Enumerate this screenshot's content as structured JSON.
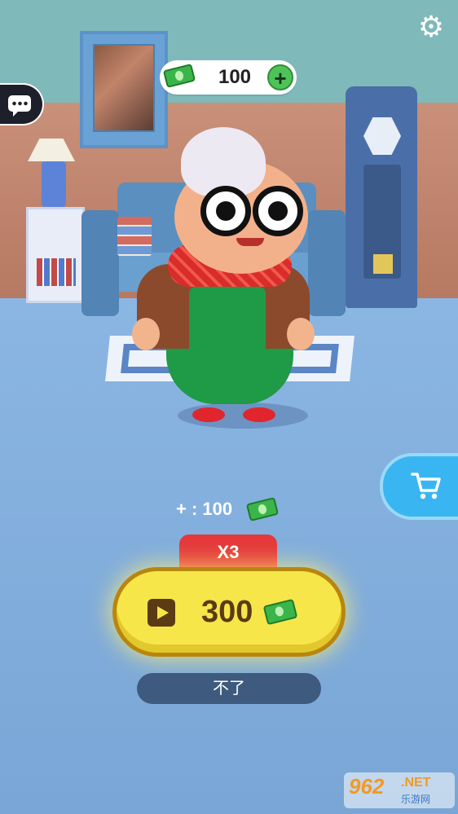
{
  "hud": {
    "settings_icon": "gear-icon",
    "chat_icon": "chat-bubble-icon",
    "money": {
      "value": "100",
      "icon": "cash-icon",
      "plus_label": "+"
    }
  },
  "shop": {
    "icon": "cart-icon"
  },
  "reward": {
    "base_label": "+ : 100",
    "icon": "cash-icon",
    "multiplier_label": "X3",
    "ad_amount": "300",
    "ad_icon": "play-video-icon"
  },
  "decline": {
    "label": "不了"
  },
  "watermark": {
    "logo": "962",
    "net": ".NET",
    "sub": "乐游网"
  },
  "colors": {
    "ad_button": "#f6e64a",
    "multiplier_tag": "#e4383b",
    "shop_button": "#39b6f2",
    "decline_button": "#3e5a7e",
    "cash_green": "#3bb54a"
  }
}
